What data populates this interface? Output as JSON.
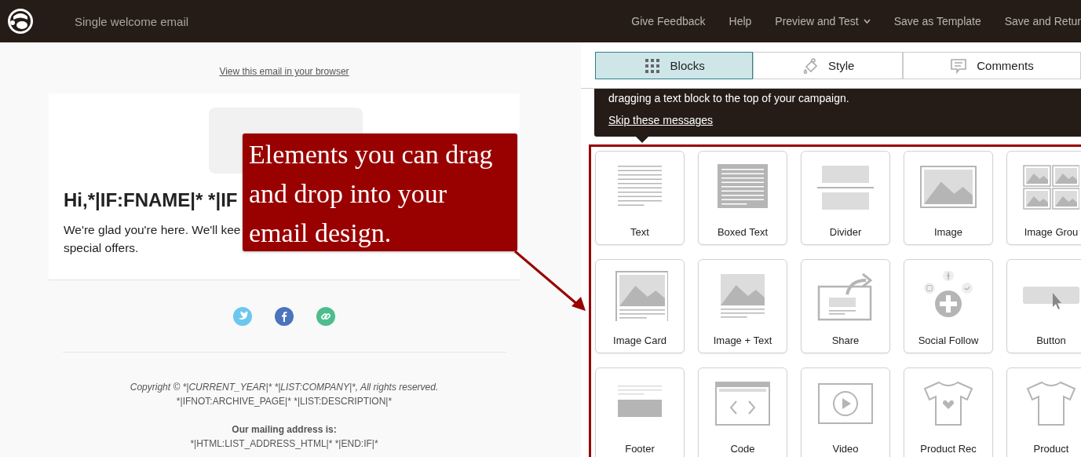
{
  "top_bar": {
    "title": "Single welcome email",
    "nav": [
      {
        "label": "Give Feedback",
        "dropdown": false
      },
      {
        "label": "Help",
        "dropdown": false
      },
      {
        "label": "Preview and Test",
        "dropdown": true
      },
      {
        "label": "Save as Template",
        "dropdown": false
      },
      {
        "label": "Save and Retur",
        "dropdown": false
      }
    ]
  },
  "email": {
    "browser_link": "View this email in your browser",
    "heading": "Hi,*|IF:FNAME|* *|IF",
    "body_lines": [
      "We're glad you're here. We'll kee",
      "special offers."
    ],
    "social": [
      {
        "kind": "twitter",
        "color": "#6bc7ee"
      },
      {
        "kind": "facebook",
        "color": "#4a74bd"
      },
      {
        "kind": "link",
        "color": "#4dbd8e"
      }
    ],
    "footer": {
      "copyright": "Copyright © *|CURRENT_YEAR|* *|LIST:COMPANY|*, All rights reserved.",
      "description": "*|IFNOT:ARCHIVE_PAGE|* *|LIST:DESCRIPTION|*",
      "address_label": "Our mailing address is:",
      "address": "*|HTML:LIST_ADDRESS_HTML|* *|END:IF|*"
    }
  },
  "callout": {
    "text": "Elements you can drag and drop into your email design."
  },
  "panel": {
    "tabs": [
      {
        "label": "Blocks",
        "kind": "blocks",
        "selected": true
      },
      {
        "label": "Style",
        "kind": "style",
        "selected": false
      },
      {
        "label": "Comments",
        "kind": "comments",
        "selected": false
      }
    ],
    "tip": {
      "text": "dragging a text block to the top of your campaign.",
      "link": "Skip these messages"
    },
    "blocks": [
      {
        "label": "Text",
        "kind": "text"
      },
      {
        "label": "Boxed Text",
        "kind": "boxed"
      },
      {
        "label": "Divider",
        "kind": "divider"
      },
      {
        "label": "Image",
        "kind": "image"
      },
      {
        "label": "Image Grou",
        "kind": "gallery"
      },
      {
        "label": "Image Card",
        "kind": "card"
      },
      {
        "label": "Image + Text",
        "kind": "imagetext"
      },
      {
        "label": "Share",
        "kind": "share"
      },
      {
        "label": "Social Follow",
        "kind": "social"
      },
      {
        "label": "Button",
        "kind": "button"
      },
      {
        "label": "Footer",
        "kind": "footer"
      },
      {
        "label": "Code",
        "kind": "code"
      },
      {
        "label": "Video",
        "kind": "video"
      },
      {
        "label": "Product Rec",
        "kind": "recommendation"
      },
      {
        "label": "Product",
        "kind": "product"
      }
    ]
  }
}
